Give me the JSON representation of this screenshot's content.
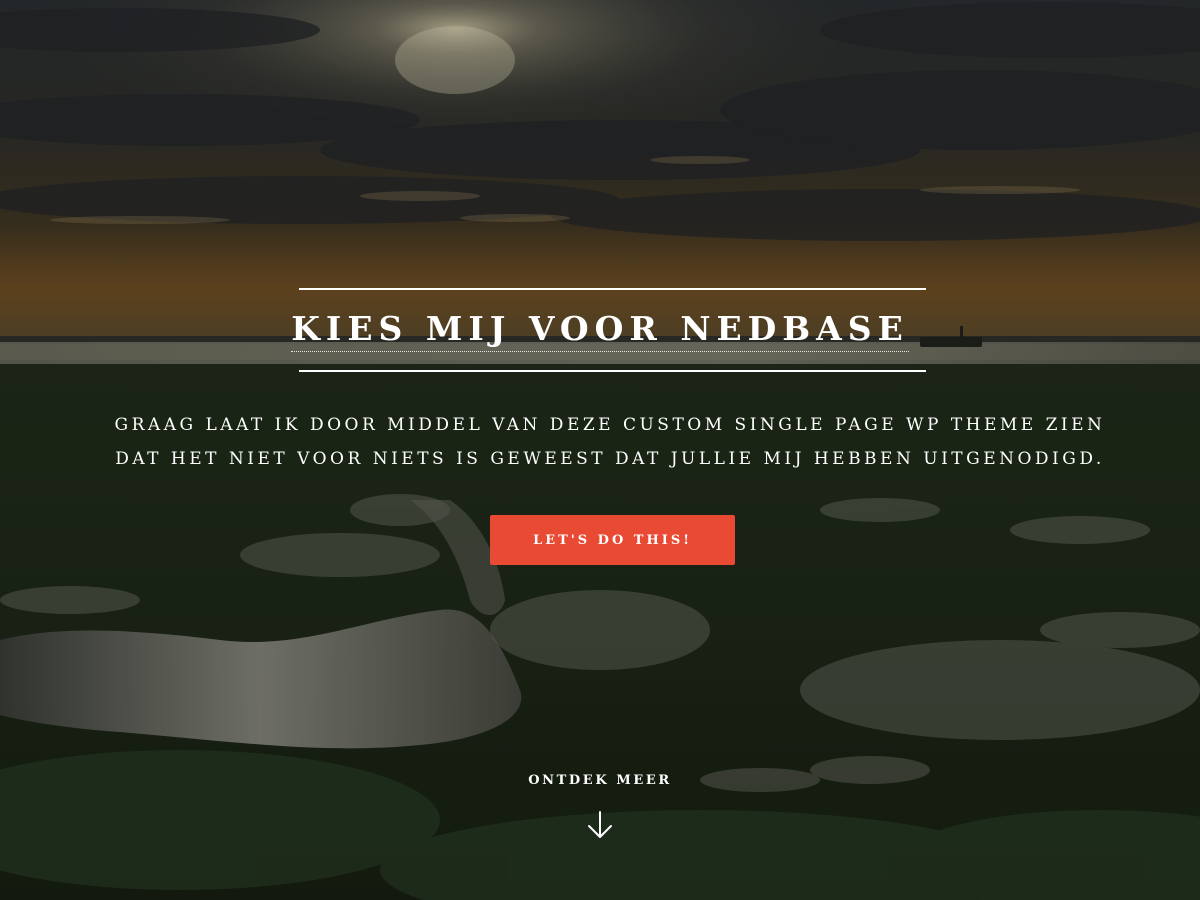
{
  "hero": {
    "headline": "KIES MIJ VOOR NEDBASE",
    "lead_lines": [
      "GRAAG LAAT IK DOOR MIDDEL VAN DEZE CUSTOM SINGLE PAGE WP THEME ZIEN",
      "DAT HET NIET VOOR NIETS IS GEWEEST DAT JULLIE MIJ HEBBEN UITGENODIGD."
    ],
    "cta_label": "LET'S DO THIS!",
    "more_label": "ONTDEK MEER",
    "more_icon": "arrow-down-icon"
  },
  "colors": {
    "cta": "#e84a34",
    "text": "#ffffff"
  }
}
